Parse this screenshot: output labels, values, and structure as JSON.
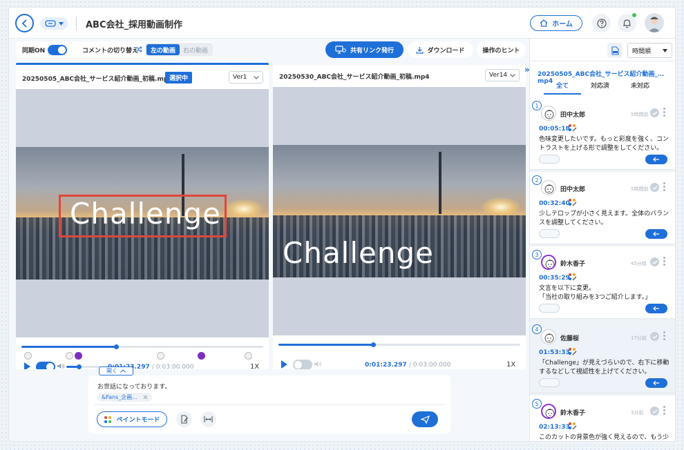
{
  "header": {
    "title": "ABC会社_採用動画制作",
    "home_label": "ホーム"
  },
  "toolbar": {
    "sync_label": "同期ON",
    "comment_switch_label": "コメントの切り替え",
    "left_video_label": "左の動画",
    "right_video_label": "右の動画",
    "share_label": "共有リンク発行",
    "download_label": "ダウンロード",
    "hint_label": "操作のヒント"
  },
  "left_video": {
    "filename": "20250505_ABC会社_サービス紹介動画_初稿.mp4",
    "selected_badge": "選択中",
    "version": "Ver1",
    "overlay_text": "Challenge",
    "progress": 0.39,
    "current_time": "0:01:23.297",
    "duration": "/ 0:03:00.000",
    "speed": "1X",
    "sync_toggle_on": true
  },
  "right_video": {
    "filename": "20250530_ABC会社_サービス紹介動画_初稿.mp4",
    "version": "Ver14",
    "overlay_text": "Challenge",
    "progress": 0.39,
    "current_time": "0:01:23.297",
    "duration": "/ 0:03:00.000",
    "speed": "1X",
    "sync_toggle_on": false
  },
  "composer": {
    "open_label": "開く",
    "text": "お世話になっております。",
    "tag": "&Fans_企画...",
    "paint_mode_label": "ペイントモード"
  },
  "comments_panel": {
    "sort_label": "時間順",
    "filename": "20250505_ABC会社_サービス紹介動画_…mp4",
    "tabs": [
      "全て",
      "対応済",
      "未対応"
    ],
    "comments": [
      {
        "num": "1",
        "name": "田中太郎",
        "ago": "5時間前",
        "time": "00:05:18",
        "body": "色味変更したいです。もっと彩度を強く、コントラストを上げる形で調整をしてください。"
      },
      {
        "num": "2",
        "name": "田中太郎",
        "ago": "5時間前",
        "time": "00:32:40",
        "body": "少しテロップが小さく見えます。全体のバランスを調整してください。"
      },
      {
        "num": "3",
        "name": "鈴木香子",
        "ago": "45分前",
        "time": "00:35:29",
        "body": "文言を以下に変更。\n「当社の取り組みを3つご紹介します。」"
      },
      {
        "num": "4",
        "name": "佐藤桜",
        "ago": "17分前",
        "time": "01:53:33",
        "body": "「Challenge」が見えづらいので、右下に移動するなどして視認性を上げてください。"
      },
      {
        "num": "5",
        "name": "鈴木香子",
        "ago": "3分前",
        "time": "02:13:33",
        "body": "このカットの背景色が強く見えるので、もう少し白に寄せてください。"
      }
    ]
  },
  "colors": {
    "accent": "#1f6fd8",
    "highlight_box": "#e0463a",
    "avatar_ring_purple": "#8e2fd0",
    "online_dot": "#3cc35b"
  }
}
